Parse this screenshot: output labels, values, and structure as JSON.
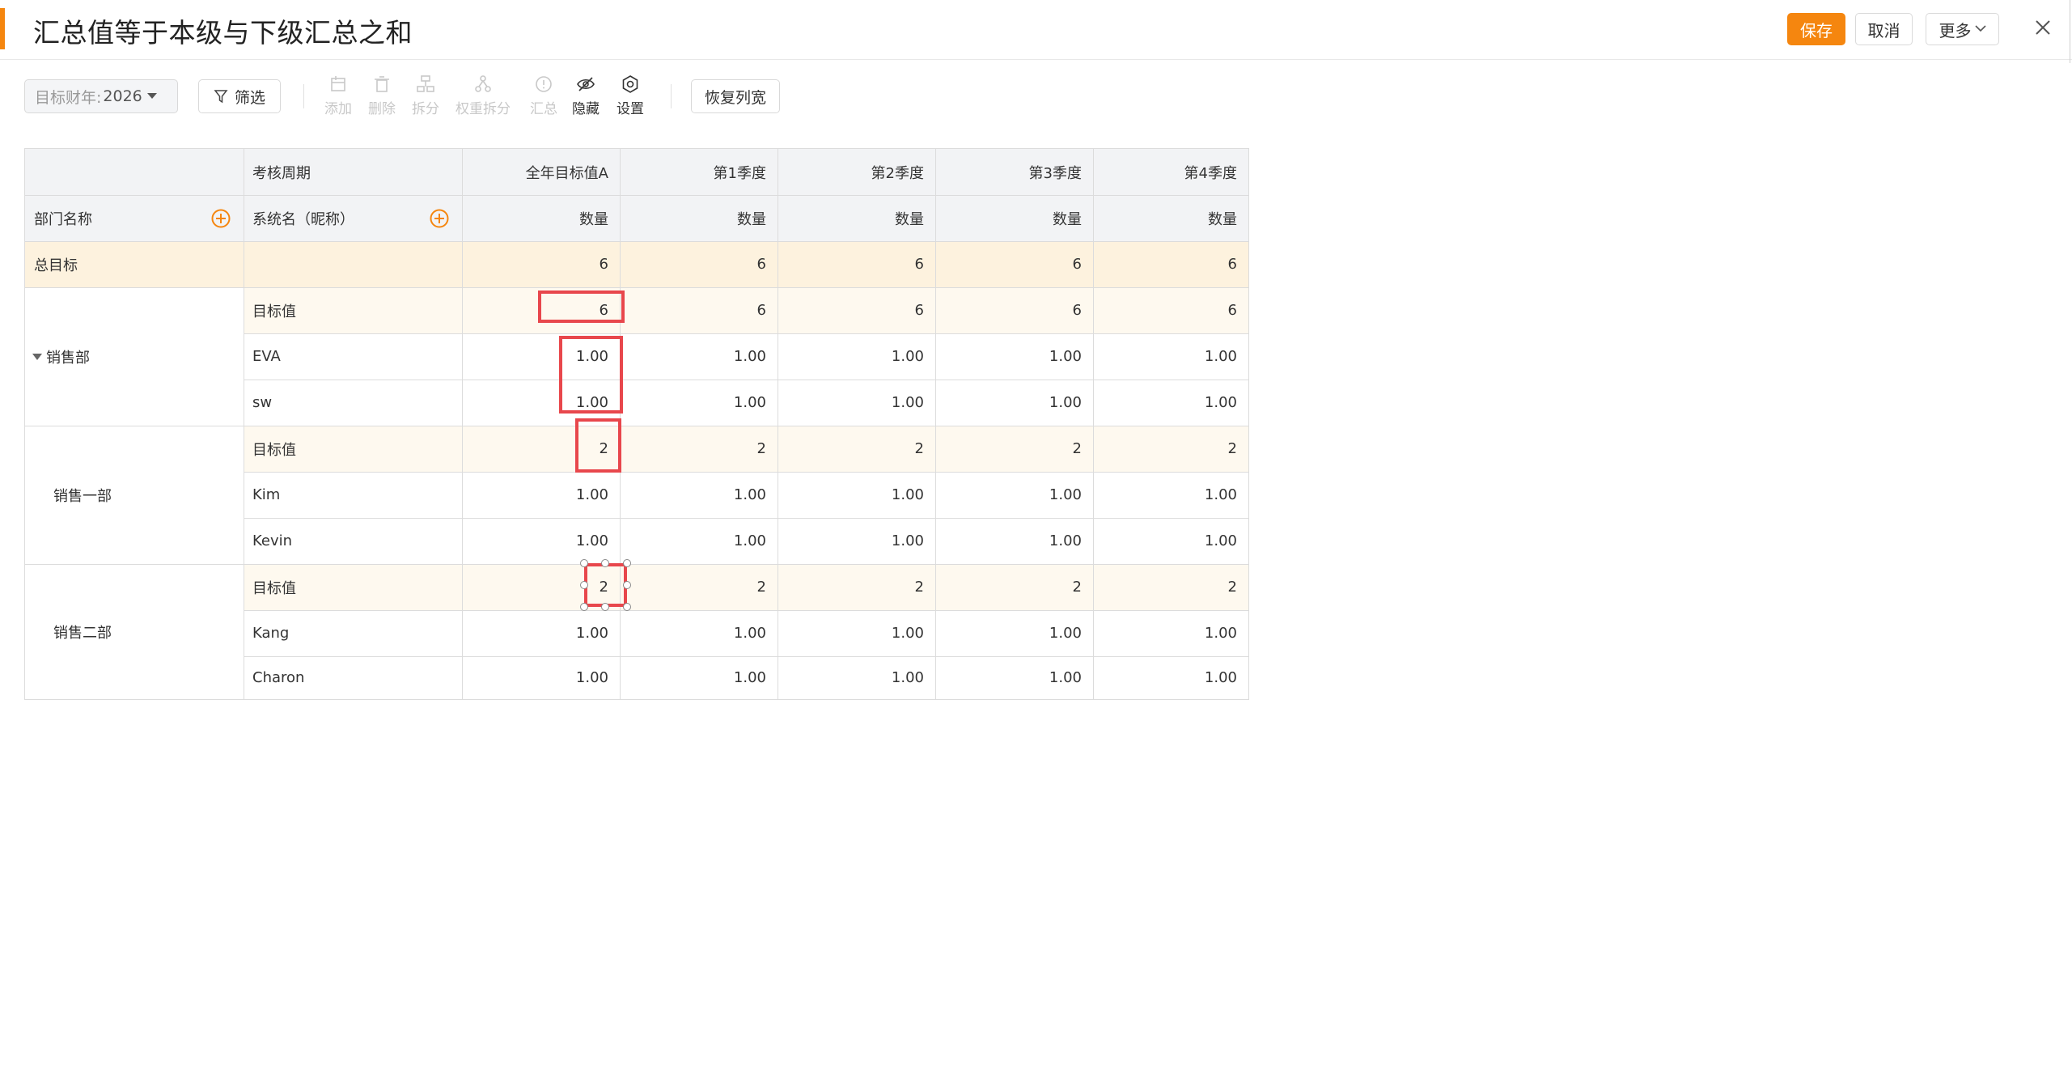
{
  "header": {
    "title": "汇总值等于本级与下级汇总之和",
    "save_label": "保存",
    "cancel_label": "取消",
    "more_label": "更多"
  },
  "toolbar": {
    "fiscal_year_label": "目标财年:",
    "fiscal_year_value": "2026",
    "filter_label": "筛选",
    "actions": [
      {
        "label": "添加",
        "icon": "add-icon",
        "enabled": false
      },
      {
        "label": "删除",
        "icon": "trash-icon",
        "enabled": false
      },
      {
        "label": "拆分",
        "icon": "split-icon",
        "enabled": false
      },
      {
        "label": "权重拆分",
        "icon": "weight-split-icon",
        "enabled": false
      },
      {
        "label": "汇总",
        "icon": "summary-icon",
        "enabled": false
      },
      {
        "label": "隐藏",
        "icon": "eye-off-icon",
        "enabled": true
      },
      {
        "label": "设置",
        "icon": "gear-icon",
        "enabled": true
      }
    ],
    "restore_label": "恢复列宽"
  },
  "table": {
    "period_header": "考核周期",
    "dept_header": "部门名称",
    "name_header": "系统名（昵称）",
    "columns": [
      "全年目标值A",
      "第1季度",
      "第2季度",
      "第3季度",
      "第4季度"
    ],
    "unit": "数量",
    "total_label": "总目标",
    "total_values": [
      "6",
      "6",
      "6",
      "6",
      "6"
    ],
    "groups": [
      {
        "dept": "销售部",
        "rows": [
          {
            "name": "目标值",
            "values": [
              "6",
              "6",
              "6",
              "6",
              "6"
            ]
          },
          {
            "name": "EVA",
            "values": [
              "1.00",
              "1.00",
              "1.00",
              "1.00",
              "1.00"
            ]
          },
          {
            "name": "sw",
            "values": [
              "1.00",
              "1.00",
              "1.00",
              "1.00",
              "1.00"
            ]
          }
        ]
      },
      {
        "dept": "销售一部",
        "rows": [
          {
            "name": "目标值",
            "values": [
              "2",
              "2",
              "2",
              "2",
              "2"
            ]
          },
          {
            "name": "Kim",
            "values": [
              "1.00",
              "1.00",
              "1.00",
              "1.00",
              "1.00"
            ]
          },
          {
            "name": "Kevin",
            "values": [
              "1.00",
              "1.00",
              "1.00",
              "1.00",
              "1.00"
            ]
          }
        ]
      },
      {
        "dept": "销售二部",
        "rows": [
          {
            "name": "目标值",
            "values": [
              "2",
              "2",
              "2",
              "2",
              "2"
            ]
          },
          {
            "name": "Kang",
            "values": [
              "1.00",
              "1.00",
              "1.00",
              "1.00",
              "1.00"
            ]
          },
          {
            "name": "Charon",
            "values": [
              "1.00",
              "1.00",
              "1.00",
              "1.00",
              "1.00"
            ]
          }
        ]
      }
    ]
  },
  "colors": {
    "accent": "#f5860f",
    "total_row_bg": "#fdf2de",
    "target_row_bg": "#fef9ef",
    "header_bg": "#f2f3f5",
    "highlight": "#e8474c"
  }
}
